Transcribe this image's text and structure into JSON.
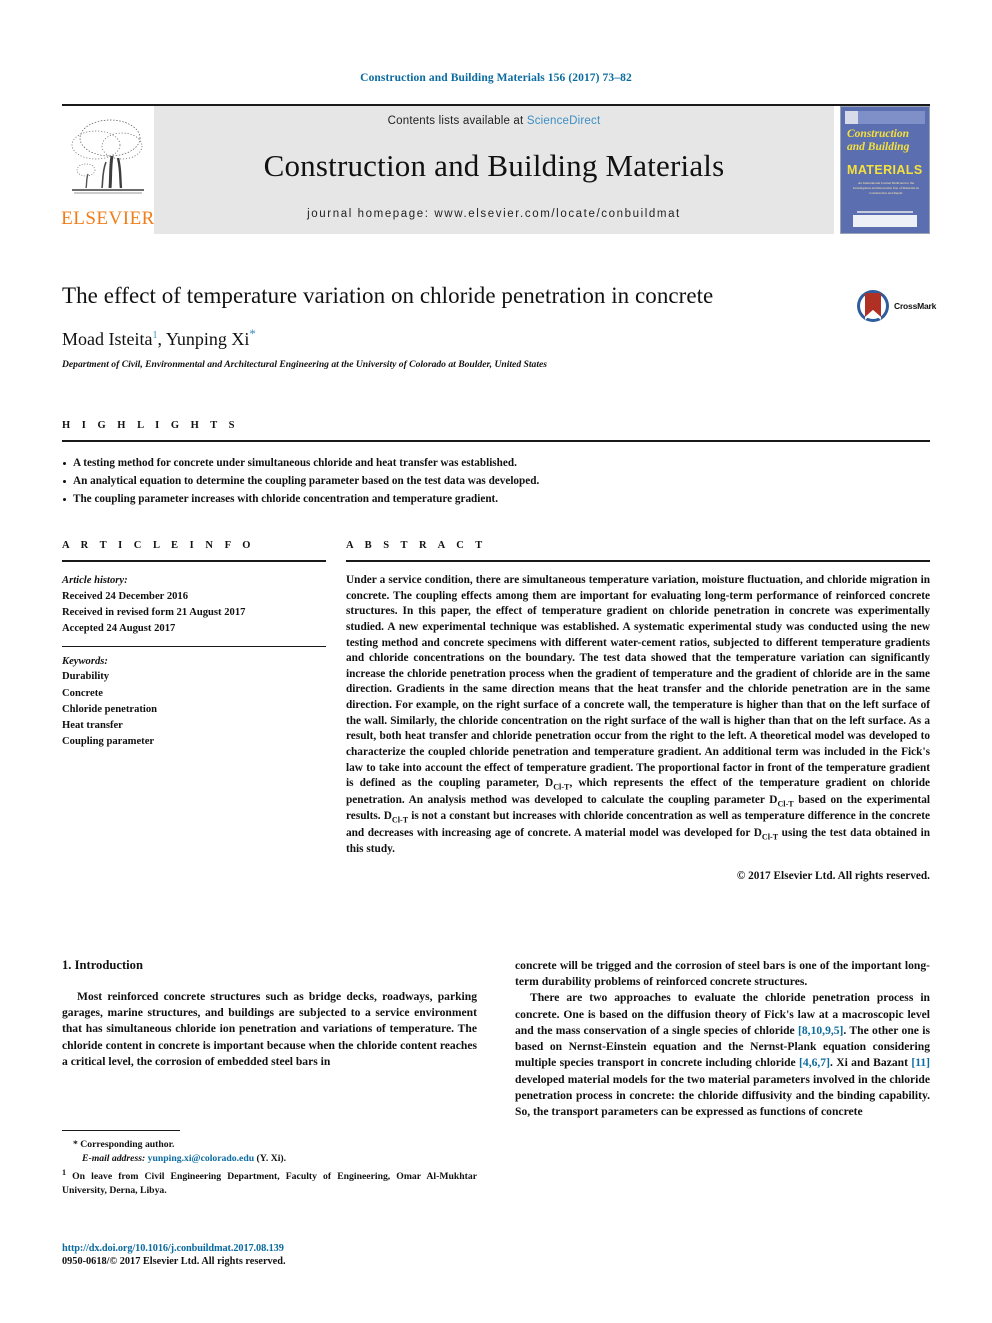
{
  "running_head": "Construction and Building Materials 156 (2017) 73–82",
  "masthead": {
    "publisher_name": "ELSEVIER",
    "contents_prefix": "Contents lists available at ",
    "contents_link": "ScienceDirect",
    "journal_name": "Construction and Building Materials",
    "homepage": "journal homepage: www.elsevier.com/locate/conbuildmat",
    "cover": {
      "title_line1": "Construction",
      "title_line2": "and Building",
      "title_line3": "MATERIALS",
      "blurb": "An International Journal Dedicated to the Investigation and Innovative Use of Materials in Construction and Repair"
    }
  },
  "article": {
    "title": "The effect of temperature variation on chloride penetration in concrete",
    "author1": "Moad Isteita",
    "author1_marker": "1",
    "author_sep": ", ",
    "author2": "Yunping Xi",
    "author2_marker": "*",
    "affiliation": "Department of Civil, Environmental and Architectural Engineering at the University of Colorado at Boulder, United States",
    "crossmark_label": "CrossMark"
  },
  "highlights": {
    "label": "H I G H L I G H T S",
    "items": [
      "A testing method for concrete under simultaneous chloride and heat transfer was established.",
      "An analytical equation to determine the coupling parameter based on the test data was developed.",
      "The coupling parameter increases with chloride concentration and temperature gradient."
    ]
  },
  "article_info": {
    "label": "A R T I C L E    I N F O",
    "history_label": "Article history:",
    "history": [
      "Received 24 December 2016",
      "Received in revised form 21 August 2017",
      "Accepted 24 August 2017"
    ],
    "keywords_label": "Keywords:",
    "keywords": [
      "Durability",
      "Concrete",
      "Chloride penetration",
      "Heat transfer",
      "Coupling parameter"
    ]
  },
  "abstract": {
    "label": "A B S T R A C T",
    "part1": "Under a service condition, there are simultaneous temperature variation, moisture fluctuation, and chloride migration in concrete. The coupling effects among them are important for evaluating long-term performance of reinforced concrete structures. In this paper, the effect of temperature gradient on chloride penetration in concrete was experimentally studied. A new experimental technique was established. A systematic experimental study was conducted using the new testing method and concrete specimens with different water-cement ratios, subjected to different temperature gradients and chloride concentrations on the boundary. The test data showed that the temperature variation can significantly increase the chloride penetration process when the gradient of temperature and the gradient of chloride are in the same direction. Gradients in the same direction means that the heat transfer and the chloride penetration are in the same direction. For example, on the right surface of a concrete wall, the temperature is higher than that on the left surface of the wall. Similarly, the chloride concentration on the right surface of the wall is higher than that on the left surface. As a result, both heat transfer and chloride penetration occur from the right to the left. A theoretical model was developed to characterize the coupled chloride penetration and temperature gradient. An additional term was included in the Fick's law to take into account the effect of temperature gradient. The proportional factor in front of the temperature gradient is defined as the coupling parameter, ",
    "sub_symbol": "Cl-T",
    "symbol_base": "D",
    "part2": ", which represents the effect of the temperature gradient on chloride penetration. An analysis method was developed to calculate the coupling parameter ",
    "part3": " based on the experimental results. ",
    "part4": " is not a constant but increases with chloride concentration as well as temperature difference in the concrete and decreases with increasing age of concrete. A material model was developed for ",
    "part5": " using the test data obtained in this study.",
    "copyright": "© 2017 Elsevier Ltd. All rights reserved."
  },
  "body": {
    "section_title": "1. Introduction",
    "left_p1": "Most reinforced concrete structures such as bridge decks, roadways, parking garages, marine structures, and buildings are subjected to a service environment that has simultaneous chloride ion penetration and variations of temperature. The chloride content in concrete is important because when the chloride content reaches a critical level, the corrosion of embedded steel bars in",
    "right_p1": "concrete will be trigged and the corrosion of steel bars is one of the important long-term durability problems of reinforced concrete structures.",
    "right_p2_a": "There are two approaches to evaluate the chloride penetration process in concrete. One is based on the diffusion theory of Fick's law at a macroscopic level and the mass conservation of a single species of chloride ",
    "cite1": "[8,10,9,5]",
    "right_p2_b": ". The other one is based on Nernst-Einstein equation and the Nernst-Plank equation considering multiple species transport in concrete including chloride ",
    "cite2": "[4,6,7]",
    "right_p2_c": ". Xi and Bazant ",
    "cite3": "[11]",
    "right_p2_d": " developed material models for the two material parameters involved in the chloride penetration process in concrete: the chloride diffusivity and the binding capability. So, the transport parameters can be expressed as functions of concrete"
  },
  "footnotes": {
    "corresponding": "* Corresponding author.",
    "email_label": "E-mail address:",
    "email": "yunping.xi@colorado.edu",
    "email_suffix": "(Y. Xi).",
    "note1_marker": "1",
    "note1": "On leave from Civil Engineering Department, Faculty of Engineering, Omar Al-Mukhtar University, Derna, Libya."
  },
  "footer": {
    "doi": "http://dx.doi.org/10.1016/j.conbuildmat.2017.08.139",
    "issn": "0950-0618/© 2017 Elsevier Ltd. All rights reserved."
  },
  "colors": {
    "link_blue": "#0b6ba0",
    "sciencedirect_blue": "#3d8ec4",
    "elsevier_orange": "#f07d1a",
    "banner_gray": "#e6e6e6"
  }
}
